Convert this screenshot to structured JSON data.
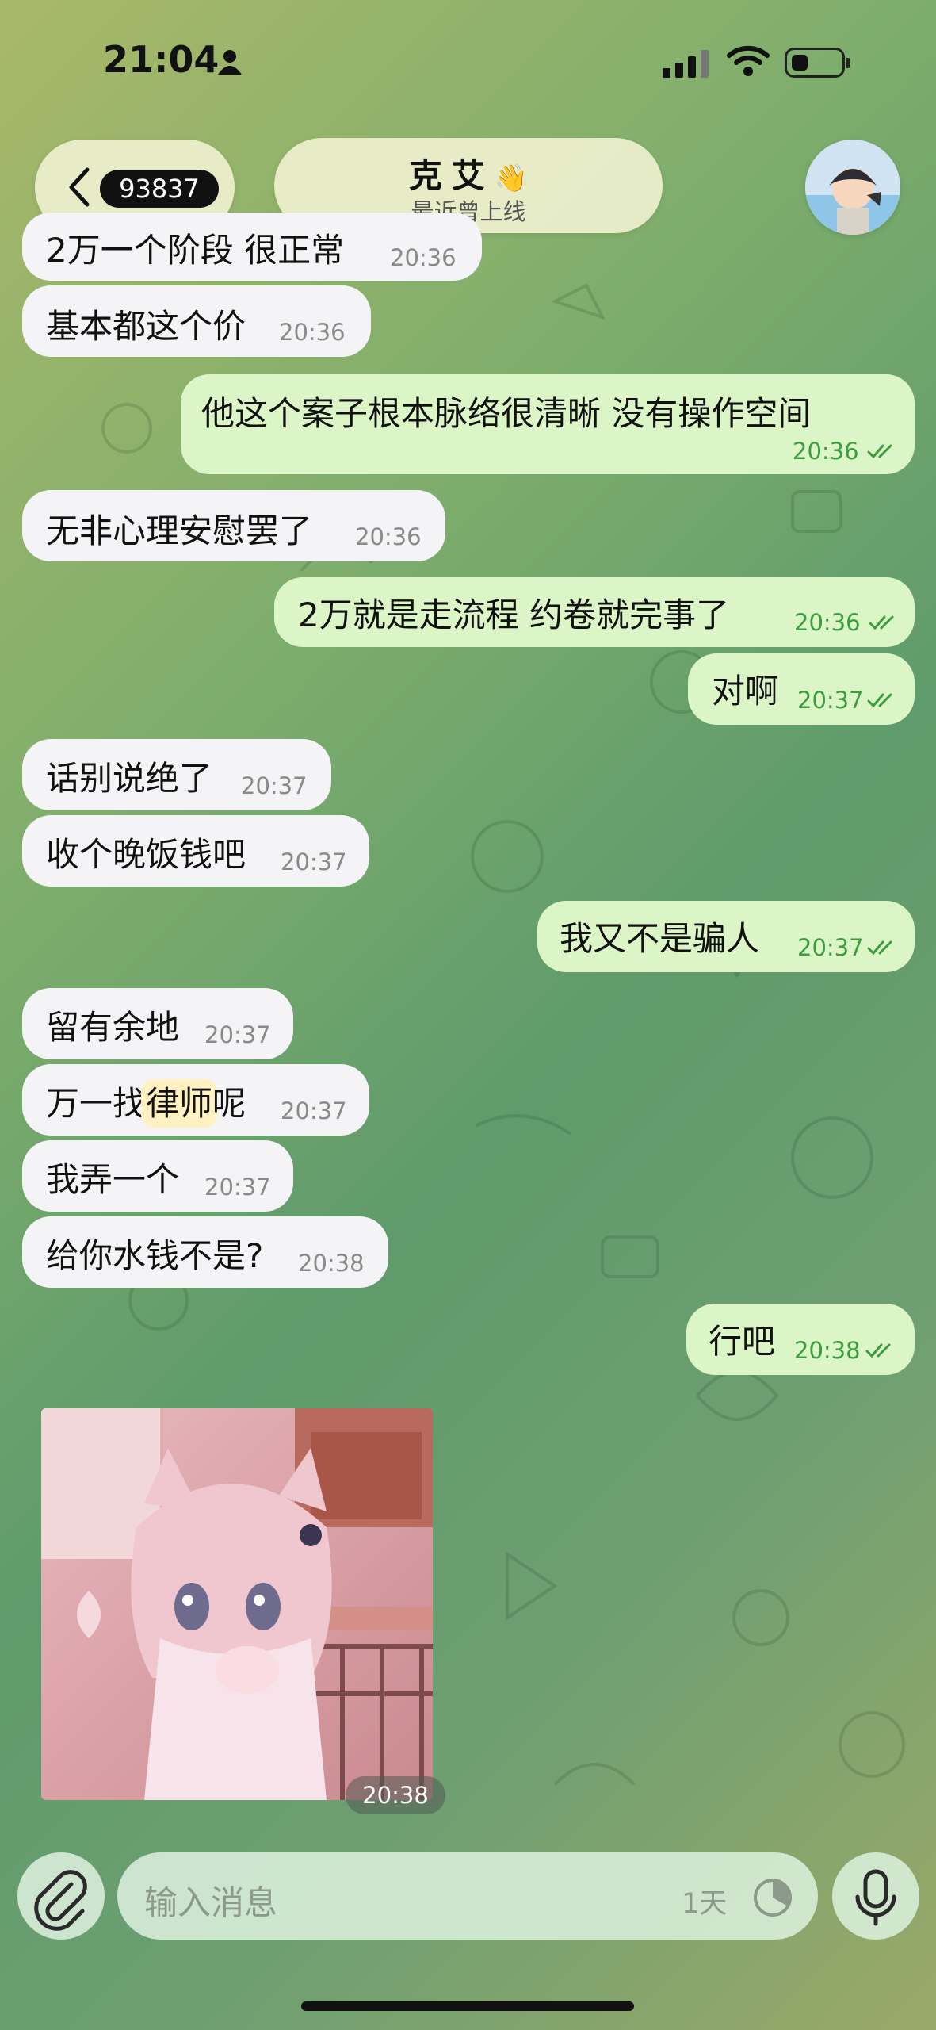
{
  "status_bar": {
    "time": "21:04"
  },
  "header": {
    "unread_count": "93837",
    "contact_name": "克艾",
    "contact_emoji": "👋",
    "contact_status": "最近曾上线"
  },
  "messages": [
    {
      "dir": "in",
      "text": "2万一个阶段 很正常",
      "time": "20:36"
    },
    {
      "dir": "in",
      "text": "基本都这个价",
      "time": "20:36"
    },
    {
      "dir": "out",
      "text": "他这个案子根本脉络很清晰 没有操作空间",
      "time": "20:36"
    },
    {
      "dir": "in",
      "text": "无非心理安慰罢了",
      "time": "20:36"
    },
    {
      "dir": "out",
      "text": "2万就是走流程 约卷就完事了",
      "time": "20:36"
    },
    {
      "dir": "out",
      "text": "对啊",
      "time": "20:37"
    },
    {
      "dir": "in",
      "text": "话别说绝了",
      "time": "20:37"
    },
    {
      "dir": "in",
      "text": "收个晚饭钱吧",
      "time": "20:37"
    },
    {
      "dir": "out",
      "text": "我又不是骗人",
      "time": "20:37"
    },
    {
      "dir": "in",
      "text": "留有余地",
      "time": "20:37"
    },
    {
      "dir": "in",
      "text_before": "万一找",
      "text_highlight": "律师",
      "text_after": "呢",
      "time": "20:37"
    },
    {
      "dir": "in",
      "text": "我弄一个",
      "time": "20:37"
    },
    {
      "dir": "in",
      "text": "给你水钱不是?",
      "time": "20:38"
    },
    {
      "dir": "out",
      "text": "行吧",
      "time": "20:38"
    }
  ],
  "photo_message": {
    "time": "20:38"
  },
  "composer": {
    "placeholder": "输入消息",
    "self_destruct_label": "1天"
  },
  "icons": {
    "status": [
      "person-icon",
      "signal-icon",
      "wifi-icon",
      "battery-icon"
    ],
    "header": [
      "chevron-left-icon",
      "waving-hand-icon",
      "avatar"
    ],
    "composer": [
      "paperclip-icon",
      "timer-icon",
      "microphone-icon"
    ]
  },
  "colors": {
    "incoming_bubble": "#f4f4f6",
    "outgoing_bubble": "#dcf5c6",
    "outgoing_time": "#3c9d3e",
    "highlight": "#fff1c2"
  }
}
